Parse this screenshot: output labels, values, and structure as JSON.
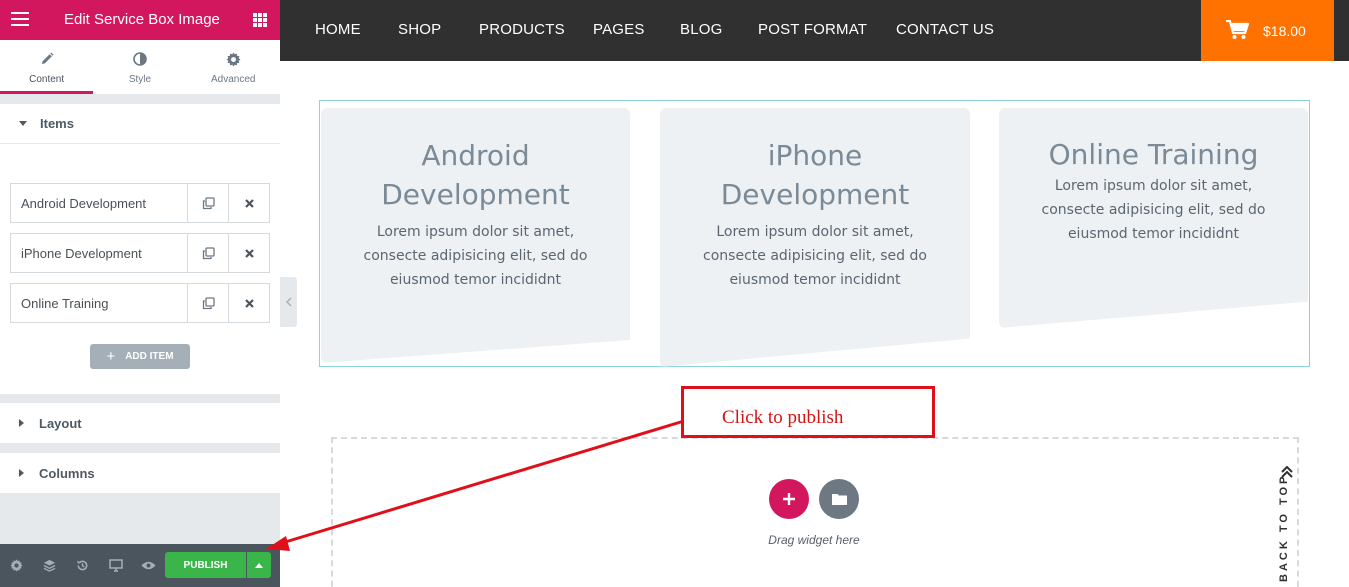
{
  "sidebar": {
    "title": "Edit Service Box Image",
    "tabs": [
      {
        "label": "Content",
        "icon": "pencil-icon"
      },
      {
        "label": "Style",
        "icon": "contrast-icon"
      },
      {
        "label": "Advanced",
        "icon": "gear-icon"
      }
    ],
    "sections": {
      "items": "Items",
      "layout": "Layout",
      "columns": "Columns"
    },
    "repeater_items": [
      {
        "label": "Android Development"
      },
      {
        "label": "iPhone Development"
      },
      {
        "label": "Online Training"
      }
    ],
    "add_item_label": "ADD ITEM",
    "publish_label": "PUBLISH"
  },
  "nav": {
    "items": [
      "HOME",
      "SHOP",
      "PRODUCTS",
      "PAGES",
      "BLOG",
      "POST FORMAT",
      "CONTACT US"
    ],
    "cart_total": "$18.00"
  },
  "cards": [
    {
      "title_line1": "Android",
      "title_line2": "Development",
      "text_line1": "Lorem ipsum dolor sit amet,",
      "text_line2": "consecte adipisicing elit, sed do",
      "text_line3": "eiusmod temor incididnt"
    },
    {
      "title_line1": "iPhone",
      "title_line2": "Development",
      "text_line1": "Lorem ipsum dolor sit amet,",
      "text_line2": "consecte adipisicing elit, sed do",
      "text_line3": "eiusmod temor incididnt"
    },
    {
      "title_line1": "Online Training",
      "text_line1": "Lorem ipsum dolor sit amet,",
      "text_line2": "consecte adipisicing elit, sed do",
      "text_line3": "eiusmod temor incididnt"
    }
  ],
  "dropzone": {
    "text": "Drag widget here"
  },
  "back_to_top": "BACK TO TOP",
  "annotation": {
    "text": "Click to publish"
  },
  "colors": {
    "brand": "#d3175f",
    "nav_bg": "#303030",
    "cart_bg": "#ff7200",
    "publish": "#39b54a",
    "annotation": "#e0101a"
  }
}
